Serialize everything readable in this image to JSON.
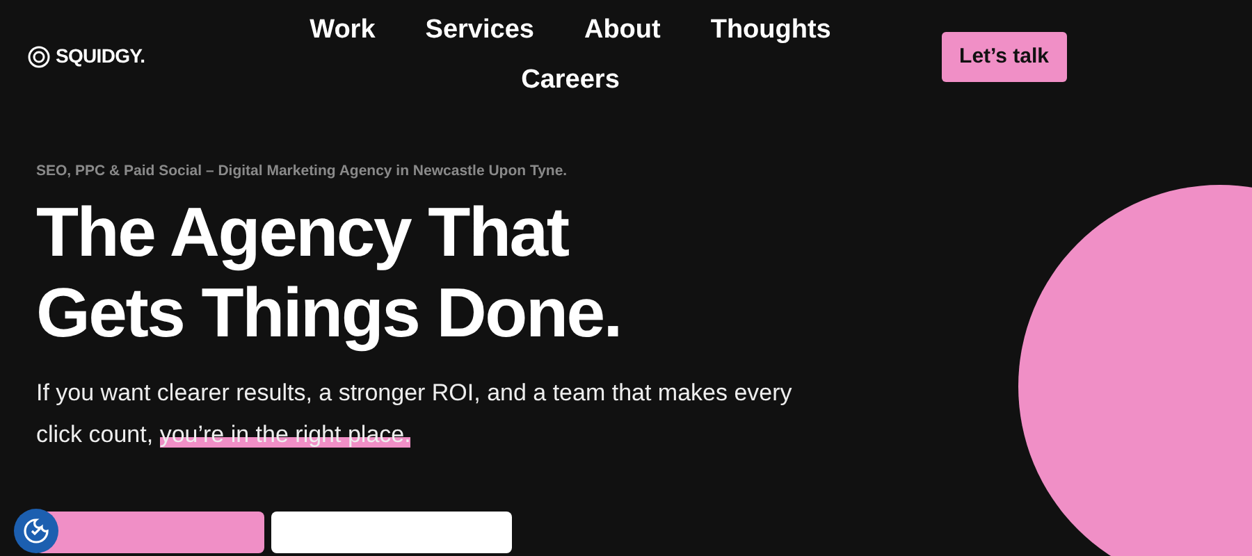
{
  "logo": {
    "text": "SQUIDGY."
  },
  "nav": [
    {
      "label": "Work"
    },
    {
      "label": "Services"
    },
    {
      "label": "About"
    },
    {
      "label": "Thoughts"
    },
    {
      "label": "Careers"
    }
  ],
  "cta": {
    "label": "Let’s talk"
  },
  "hero": {
    "eyebrow": "SEO, PPC & Paid Social – Digital Marketing Agency in Newcastle Upon Tyne.",
    "title": "The Agency That Gets Things Done.",
    "lead": "If you want clearer results, a stronger ROI, and a team that makes every click count,",
    "highlight": "you’re in the right place."
  }
}
